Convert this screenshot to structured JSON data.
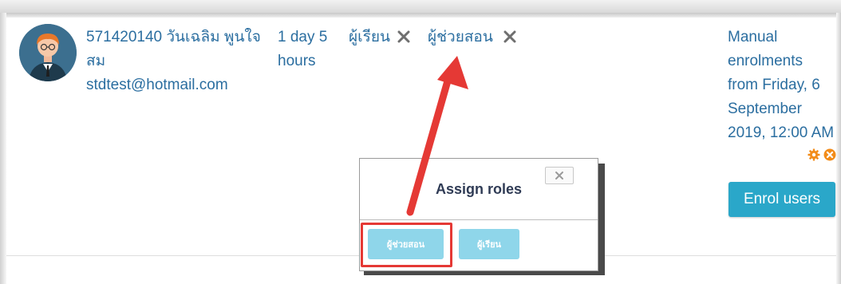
{
  "user": {
    "name": "571420140 วันเฉลิม พูนใจสม",
    "email": "stdtest@hotmail.com"
  },
  "last_access": "1 day 5 hours",
  "roles": [
    {
      "label": "ผู้เรียน"
    },
    {
      "label": "ผู้ช่วยสอน"
    }
  ],
  "enrolment": {
    "method": "Manual enrolments from Friday, 6 September 2019, 12:00 AM"
  },
  "enrol_button": {
    "label": "Enrol users"
  },
  "dialog": {
    "title": "Assign roles",
    "buttons": [
      {
        "label": "ผู้ช่วยสอน"
      },
      {
        "label": "ผู้เรียน"
      }
    ]
  },
  "colors": {
    "link": "#2b6ea0",
    "button": "#2aa7c9",
    "role_button": "#8fd6ea",
    "highlight": "#e53935",
    "icon_orange": "#f28c1a"
  }
}
